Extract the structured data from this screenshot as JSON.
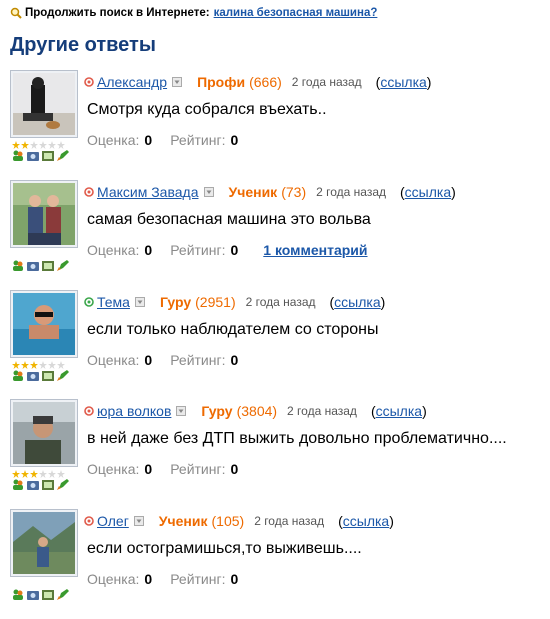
{
  "search_prompt": {
    "label": "Продолжить поиск в Интернете:",
    "query": "калина безопасная машина?"
  },
  "section_title": "Другие ответы",
  "answers": [
    {
      "username": "Александр",
      "rank": "Профи",
      "points": "(666)",
      "ago": "2 года назад",
      "link_open": "(",
      "link_label": "ссылка",
      "link_close": ")",
      "text": "Смотря куда собрался въехать..",
      "score_label": "Оценка:",
      "score": "0",
      "rating_label": "Рейтинг:",
      "rating": "0",
      "stars_filled": 2,
      "status": "red-dot"
    },
    {
      "username": "Максим Завада",
      "rank": "Ученик",
      "points": "(73)",
      "ago": "2 года назад",
      "link_open": "(",
      "link_label": "ссылка",
      "link_close": ")",
      "text": "самая безопасная машина это вольва",
      "score_label": "Оценка:",
      "score": "0",
      "rating_label": "Рейтинг:",
      "rating": "0",
      "comments": "1 комментарий",
      "stars_filled": 0,
      "status": "red-dot"
    },
    {
      "username": "Тема",
      "rank": "Гуру",
      "points": "(2951)",
      "ago": "2 года назад",
      "link_open": "(",
      "link_label": "ссылка",
      "link_close": ")",
      "text": "если только наблюдателем со стороны",
      "score_label": "Оценка:",
      "score": "0",
      "rating_label": "Рейтинг:",
      "rating": "0",
      "stars_filled": 3,
      "status": "green-dot"
    },
    {
      "username": "юра волков",
      "rank": "Гуру",
      "points": "(3804)",
      "ago": "2 года назад",
      "link_open": "(",
      "link_label": "ссылка",
      "link_close": ")",
      "text": "в ней даже без ДТП выжить довольно проблематично....",
      "score_label": "Оценка:",
      "score": "0",
      "rating_label": "Рейтинг:",
      "rating": "0",
      "stars_filled": 3,
      "status": "red-dot"
    },
    {
      "username": "Олег",
      "rank": "Ученик",
      "points": "(105)",
      "ago": "2 года назад",
      "link_open": "(",
      "link_label": "ссылка",
      "link_close": ")",
      "text": "если остограмишься,то выживешь....",
      "score_label": "Оценка:",
      "score": "0",
      "rating_label": "Рейтинг:",
      "rating": "0",
      "stars_filled": 0,
      "status": "red-dot"
    }
  ],
  "colors": {
    "link": "#1b57a8",
    "title": "#153d7a",
    "rank": "#ee6a00",
    "star_on": "#f0b400",
    "star_off": "#d8d8d8"
  }
}
